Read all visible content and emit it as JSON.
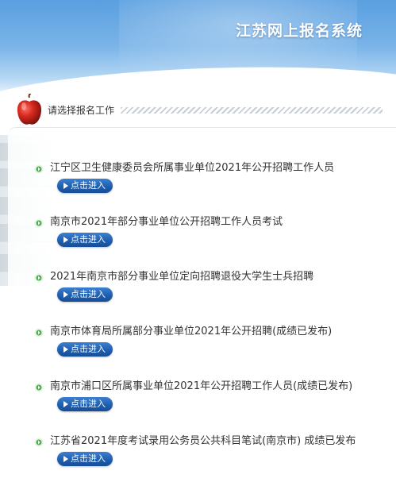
{
  "header": {
    "site_title": "江苏网上报名系统"
  },
  "section": {
    "label": "请选择报名工作"
  },
  "enter_label": "点击进入",
  "items": [
    {
      "title": "江宁区卫生健康委员会所属事业单位2021年公开招聘工作人员"
    },
    {
      "title": "南京市2021年部分事业单位公开招聘工作人员考试"
    },
    {
      "title": "2021年南京市部分事业单位定向招聘退役大学生士兵招聘"
    },
    {
      "title": "南京市体育局所属部分事业单位2021年公开招聘(成绩已发布)"
    },
    {
      "title": "南京市浦口区所属事业单位2021年公开招聘工作人员(成绩已发布)"
    },
    {
      "title": "江苏省2021年度考试录用公务员公共科目笔试(南京市) 成绩已发布"
    }
  ],
  "colors": {
    "header_blue": "#5a9fe0",
    "button_blue": "#1f5fb0",
    "icon_green": "#4caf50"
  },
  "icons": {
    "decor": "apple-icon",
    "bullet": "green-bullet-icon",
    "button": "play-icon"
  }
}
